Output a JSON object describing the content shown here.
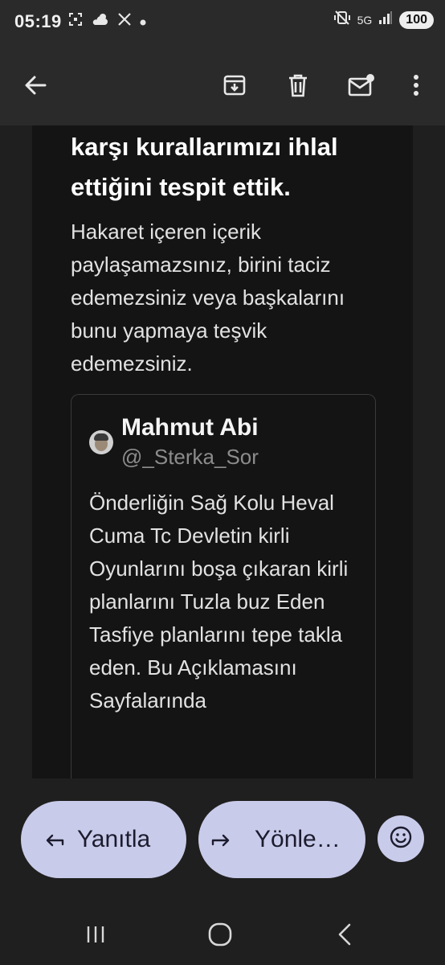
{
  "status_bar": {
    "time": "05:19",
    "left_icons": [
      "screenshot-icon",
      "weather-icon",
      "x-icon",
      "dot-icon"
    ],
    "right_icons": [
      "mute-vibrate-icon",
      "wifi-5g-icon",
      "signal-icon"
    ],
    "network_label": "5G",
    "battery": "100"
  },
  "app_bar": {
    "icons": [
      "back-arrow-icon",
      "archive-icon",
      "delete-icon",
      "mark-unread-icon",
      "more-vert-icon"
    ]
  },
  "email": {
    "headline": "karşı kurallarımızı ihlal ettiğini tespit ettik.",
    "paragraph": "Hakaret içeren içerik paylaşamazsınız, birini taciz edemezsiniz veya başkalarını bunu yapmaya teşvik edemezsiniz.",
    "tweet": {
      "name": "Mahmut Abi",
      "handle": "@_Sterka_Sor",
      "body": "Önderliğin Sağ Kolu Heval Cuma Tc Devletin kirli Oyunlarını boşa çıkaran kirli planlarını Tuzla buz Eden Tasfiye planlarını tepe takla eden. Bu Açıklamasını Sayfalarında"
    }
  },
  "actions": {
    "reply_label": "Yanıtla",
    "forward_label": "Yönle…",
    "reply_icon": "reply-arrow-icon",
    "forward_icon": "forward-arrow-icon",
    "emoji_icon": "emoji-smile-icon"
  },
  "nav_bar": {
    "icons": [
      "recents-icon",
      "home-icon",
      "back-icon"
    ]
  },
  "colors": {
    "background": "#1f1f1f",
    "card": "#141414",
    "pill": "#c9cbea"
  }
}
